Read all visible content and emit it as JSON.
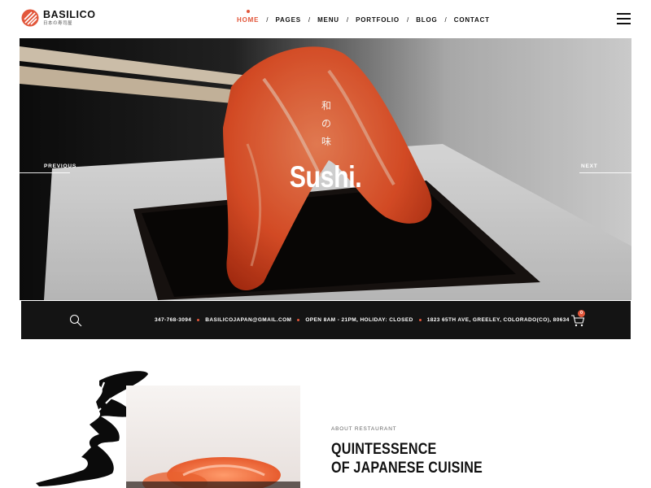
{
  "brand": {
    "name": "BASILICO",
    "tagline": "日本の寿司屋",
    "accent_color": "#e2573b"
  },
  "nav": {
    "items": [
      {
        "label": "HOME",
        "active": true
      },
      {
        "label": "PAGES",
        "active": false
      },
      {
        "label": "MENU",
        "active": false
      },
      {
        "label": "PORTFOLIO",
        "active": false
      },
      {
        "label": "BLOG",
        "active": false
      },
      {
        "label": "CONTACT",
        "active": false
      }
    ],
    "separator": "/",
    "menu_icon": "hamburger-icon"
  },
  "hero": {
    "kanji": [
      "和",
      "の",
      "味"
    ],
    "title": "Sushi.",
    "prev_label": "PREVIOUS",
    "next_label": "NEXT"
  },
  "infobar": {
    "search_icon": "search-icon",
    "phone": "347-768-3094",
    "email": "BASILICOJAPAN@GMAIL.COM",
    "hours": "OPEN 8AM - 21PM, HOLIDAY: CLOSED",
    "address": "1823 65TH AVE, GREELEY, COLORADO(CO), 80634",
    "cart_icon": "cart-icon",
    "cart_count": "0"
  },
  "about": {
    "label": "ABOUT RESTAURANT",
    "heading_line1": "QUINTESSENCE",
    "heading_line2": "OF JAPANESE CUISINE"
  }
}
